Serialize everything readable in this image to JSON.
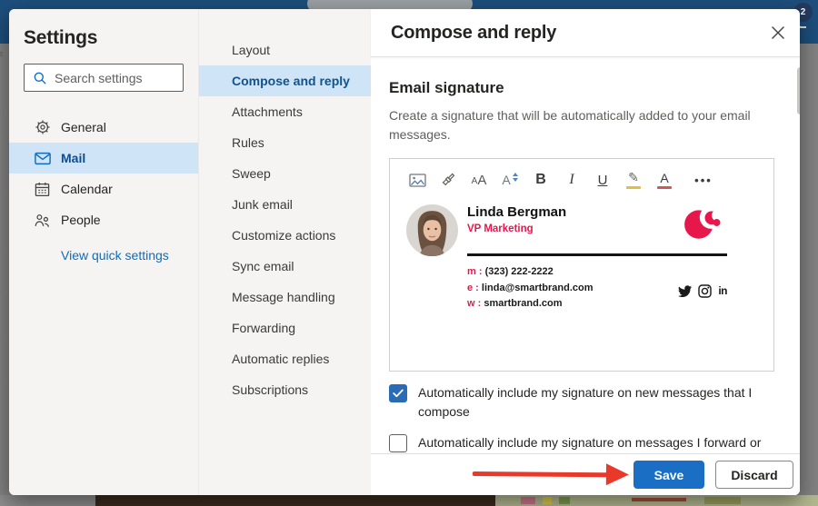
{
  "background": {
    "badge_count": "2"
  },
  "settings": {
    "title": "Settings",
    "search_placeholder": "Search settings",
    "items": [
      "General",
      "Mail",
      "Calendar",
      "People"
    ],
    "quick_settings_label": "View quick settings"
  },
  "nav": {
    "items": [
      "Layout",
      "Compose and reply",
      "Attachments",
      "Rules",
      "Sweep",
      "Junk email",
      "Customize actions",
      "Sync email",
      "Message handling",
      "Forwarding",
      "Automatic replies",
      "Subscriptions"
    ]
  },
  "panel": {
    "title": "Compose and reply",
    "section_title": "Email signature",
    "description": "Create a signature that will be automatically added to your email messages.",
    "toolbar": {
      "icons": [
        "insert-image-icon",
        "format-painter-icon",
        "font-icon",
        "font-size-icon",
        "bold-icon",
        "italic-icon",
        "underline-icon",
        "highlight-icon",
        "font-color-icon",
        "more-icon"
      ],
      "font_small": "A",
      "font_large": "A",
      "font_size_letter": "A",
      "bold": "B",
      "italic": "I",
      "underline": "U",
      "highlight": "✎",
      "font_color_letter": "A",
      "more": "•••"
    },
    "signature": {
      "name": "Linda Bergman",
      "role": "VP Marketing",
      "phone_label": "m :",
      "phone": "(323) 222-2222",
      "email_label": "e :",
      "email": "linda@smartbrand.com",
      "web_label": "w :",
      "web": "smartbrand.com",
      "social_icons": [
        "twitter",
        "instagram",
        "linkedin"
      ],
      "linkedin_text": "in",
      "brand_red": "#e8174b"
    },
    "checkboxes": [
      {
        "label": "Automatically include my signature on new messages that I compose",
        "checked": true
      },
      {
        "label": "Automatically include my signature on messages I forward or",
        "checked": false
      }
    ],
    "save_label": "Save",
    "discard_label": "Discard"
  },
  "colors": {
    "accent_blue": "#0f6cbd",
    "selected_bg": "#cfe4f7",
    "header_blue": "#1d4e7c",
    "save_blue": "#1a6fc4",
    "arrow_red": "#e8392b",
    "brand_red": "#e8174b"
  }
}
